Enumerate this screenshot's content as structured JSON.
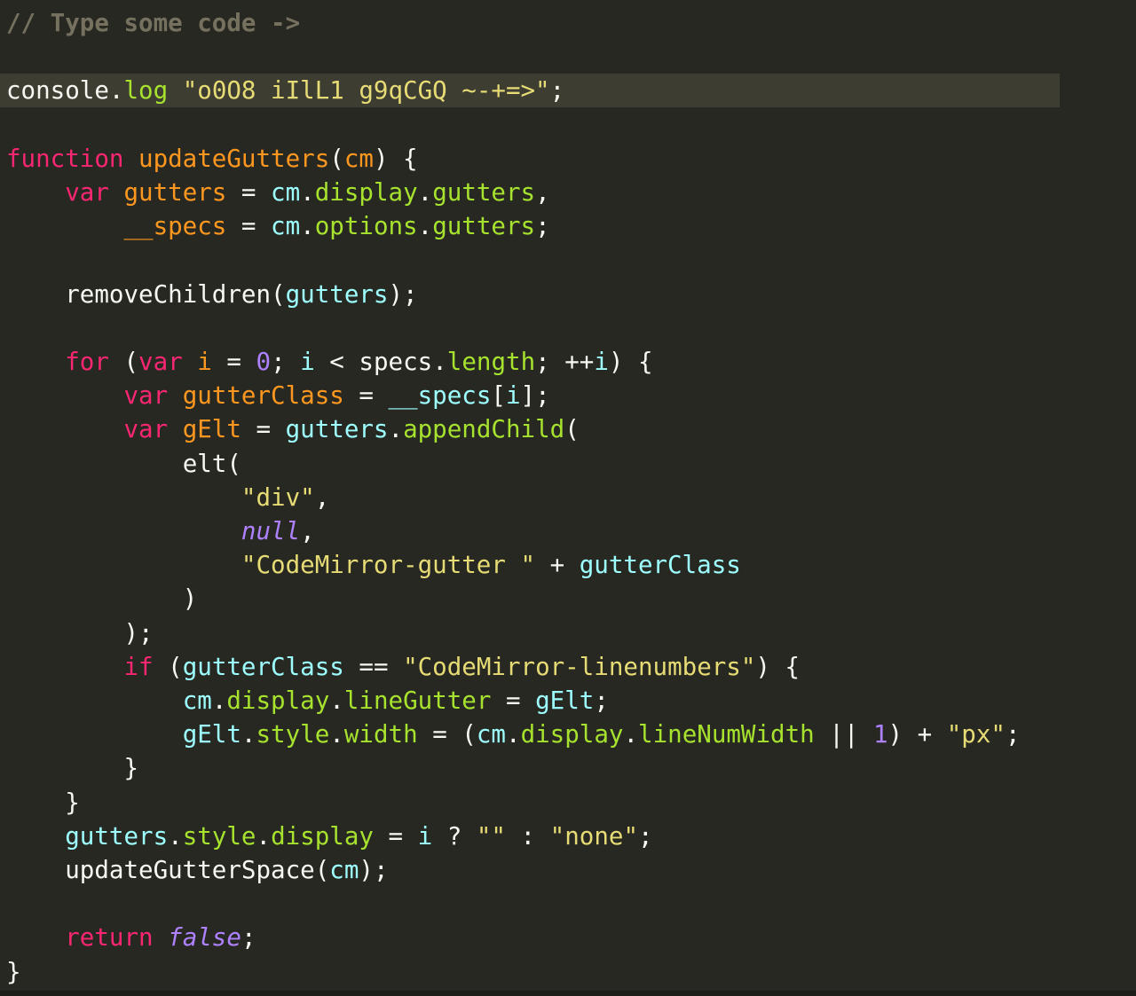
{
  "editor": {
    "theme_colors": {
      "background": "#272822",
      "active_line": "#3e3d32",
      "comment": "#75715e",
      "keyword": "#f92672",
      "definition": "#fd971f",
      "property": "#a6e22e",
      "variable": "#9effff",
      "string": "#e6db74",
      "number": "#ae81ff",
      "text": "#f8f8f2"
    },
    "active_line_index": 2,
    "lines": [
      [
        {
          "t": "// Type some code ->",
          "c": "comment"
        }
      ],
      [],
      [
        {
          "t": "console",
          "c": "plain"
        },
        {
          "t": ".",
          "c": "plain"
        },
        {
          "t": "log",
          "c": "prop"
        },
        {
          "t": " ",
          "c": "plain"
        },
        {
          "t": "\"o0O8 iIlL1 g9qCGQ ~-+=>\"",
          "c": "str"
        },
        {
          "t": ";",
          "c": "plain"
        }
      ],
      [],
      [
        {
          "t": "function",
          "c": "kw"
        },
        {
          "t": " ",
          "c": "plain"
        },
        {
          "t": "updateGutters",
          "c": "fn"
        },
        {
          "t": "(",
          "c": "plain"
        },
        {
          "t": "cm",
          "c": "param"
        },
        {
          "t": ") {",
          "c": "plain"
        }
      ],
      [
        {
          "t": "    ",
          "c": "plain"
        },
        {
          "t": "var",
          "c": "kw"
        },
        {
          "t": " ",
          "c": "plain"
        },
        {
          "t": "gutters",
          "c": "defvar"
        },
        {
          "t": " = ",
          "c": "plain"
        },
        {
          "t": "cm",
          "c": "var2"
        },
        {
          "t": ".",
          "c": "plain"
        },
        {
          "t": "display",
          "c": "prop"
        },
        {
          "t": ".",
          "c": "plain"
        },
        {
          "t": "gutters",
          "c": "prop"
        },
        {
          "t": ",",
          "c": "plain"
        }
      ],
      [
        {
          "t": "        ",
          "c": "plain"
        },
        {
          "t": "__specs",
          "c": "defvar"
        },
        {
          "t": " = ",
          "c": "plain"
        },
        {
          "t": "cm",
          "c": "var2"
        },
        {
          "t": ".",
          "c": "plain"
        },
        {
          "t": "options",
          "c": "prop"
        },
        {
          "t": ".",
          "c": "plain"
        },
        {
          "t": "gutters",
          "c": "prop"
        },
        {
          "t": ";",
          "c": "plain"
        }
      ],
      [],
      [
        {
          "t": "    ",
          "c": "plain"
        },
        {
          "t": "removeChildren",
          "c": "plain"
        },
        {
          "t": "(",
          "c": "plain"
        },
        {
          "t": "gutters",
          "c": "var2"
        },
        {
          "t": ");",
          "c": "plain"
        }
      ],
      [],
      [
        {
          "t": "    ",
          "c": "plain"
        },
        {
          "t": "for",
          "c": "kw"
        },
        {
          "t": " (",
          "c": "plain"
        },
        {
          "t": "var",
          "c": "kw"
        },
        {
          "t": " ",
          "c": "plain"
        },
        {
          "t": "i",
          "c": "defvar"
        },
        {
          "t": " = ",
          "c": "plain"
        },
        {
          "t": "0",
          "c": "num"
        },
        {
          "t": "; ",
          "c": "plain"
        },
        {
          "t": "i",
          "c": "var2"
        },
        {
          "t": " < ",
          "c": "plain"
        },
        {
          "t": "specs",
          "c": "plain"
        },
        {
          "t": ".",
          "c": "plain"
        },
        {
          "t": "length",
          "c": "prop"
        },
        {
          "t": "; ++",
          "c": "plain"
        },
        {
          "t": "i",
          "c": "var2"
        },
        {
          "t": ") {",
          "c": "plain"
        }
      ],
      [
        {
          "t": "        ",
          "c": "plain"
        },
        {
          "t": "var",
          "c": "kw"
        },
        {
          "t": " ",
          "c": "plain"
        },
        {
          "t": "gutterClass",
          "c": "defvar"
        },
        {
          "t": " = ",
          "c": "plain"
        },
        {
          "t": "__specs",
          "c": "var2"
        },
        {
          "t": "[",
          "c": "plain"
        },
        {
          "t": "i",
          "c": "var2"
        },
        {
          "t": "];",
          "c": "plain"
        }
      ],
      [
        {
          "t": "        ",
          "c": "plain"
        },
        {
          "t": "var",
          "c": "kw"
        },
        {
          "t": " ",
          "c": "plain"
        },
        {
          "t": "gElt",
          "c": "defvar"
        },
        {
          "t": " = ",
          "c": "plain"
        },
        {
          "t": "gutters",
          "c": "var2"
        },
        {
          "t": ".",
          "c": "plain"
        },
        {
          "t": "appendChild",
          "c": "prop"
        },
        {
          "t": "(",
          "c": "plain"
        }
      ],
      [
        {
          "t": "            ",
          "c": "plain"
        },
        {
          "t": "elt",
          "c": "plain"
        },
        {
          "t": "(",
          "c": "plain"
        }
      ],
      [
        {
          "t": "                ",
          "c": "plain"
        },
        {
          "t": "\"div\"",
          "c": "str"
        },
        {
          "t": ",",
          "c": "plain"
        }
      ],
      [
        {
          "t": "                ",
          "c": "plain"
        },
        {
          "t": "null",
          "c": "atom"
        },
        {
          "t": ",",
          "c": "plain"
        }
      ],
      [
        {
          "t": "                ",
          "c": "plain"
        },
        {
          "t": "\"CodeMirror-gutter \"",
          "c": "str"
        },
        {
          "t": " + ",
          "c": "plain"
        },
        {
          "t": "gutterClass",
          "c": "var2"
        }
      ],
      [
        {
          "t": "            ",
          "c": "plain"
        },
        {
          "t": ")",
          "c": "plain"
        }
      ],
      [
        {
          "t": "        ",
          "c": "plain"
        },
        {
          "t": ");",
          "c": "plain"
        }
      ],
      [
        {
          "t": "        ",
          "c": "plain"
        },
        {
          "t": "if",
          "c": "kw"
        },
        {
          "t": " (",
          "c": "plain"
        },
        {
          "t": "gutterClass",
          "c": "var2"
        },
        {
          "t": " == ",
          "c": "plain"
        },
        {
          "t": "\"CodeMirror-linenumbers\"",
          "c": "str"
        },
        {
          "t": ") {",
          "c": "plain"
        }
      ],
      [
        {
          "t": "            ",
          "c": "plain"
        },
        {
          "t": "cm",
          "c": "var2"
        },
        {
          "t": ".",
          "c": "plain"
        },
        {
          "t": "display",
          "c": "prop"
        },
        {
          "t": ".",
          "c": "plain"
        },
        {
          "t": "lineGutter",
          "c": "prop"
        },
        {
          "t": " = ",
          "c": "plain"
        },
        {
          "t": "gElt",
          "c": "var2"
        },
        {
          "t": ";",
          "c": "plain"
        }
      ],
      [
        {
          "t": "            ",
          "c": "plain"
        },
        {
          "t": "gElt",
          "c": "var2"
        },
        {
          "t": ".",
          "c": "plain"
        },
        {
          "t": "style",
          "c": "prop"
        },
        {
          "t": ".",
          "c": "plain"
        },
        {
          "t": "width",
          "c": "prop"
        },
        {
          "t": " = (",
          "c": "plain"
        },
        {
          "t": "cm",
          "c": "var2"
        },
        {
          "t": ".",
          "c": "plain"
        },
        {
          "t": "display",
          "c": "prop"
        },
        {
          "t": ".",
          "c": "plain"
        },
        {
          "t": "lineNumWidth",
          "c": "prop"
        },
        {
          "t": " || ",
          "c": "plain"
        },
        {
          "t": "1",
          "c": "num"
        },
        {
          "t": ") + ",
          "c": "plain"
        },
        {
          "t": "\"px\"",
          "c": "str"
        },
        {
          "t": ";",
          "c": "plain"
        }
      ],
      [
        {
          "t": "        ",
          "c": "plain"
        },
        {
          "t": "}",
          "c": "plain"
        }
      ],
      [
        {
          "t": "    ",
          "c": "plain"
        },
        {
          "t": "}",
          "c": "plain"
        }
      ],
      [
        {
          "t": "    ",
          "c": "plain"
        },
        {
          "t": "gutters",
          "c": "var2"
        },
        {
          "t": ".",
          "c": "plain"
        },
        {
          "t": "style",
          "c": "prop"
        },
        {
          "t": ".",
          "c": "plain"
        },
        {
          "t": "display",
          "c": "prop"
        },
        {
          "t": " = ",
          "c": "plain"
        },
        {
          "t": "i",
          "c": "var2"
        },
        {
          "t": " ? ",
          "c": "plain"
        },
        {
          "t": "\"\"",
          "c": "str"
        },
        {
          "t": " : ",
          "c": "plain"
        },
        {
          "t": "\"none\"",
          "c": "str"
        },
        {
          "t": ";",
          "c": "plain"
        }
      ],
      [
        {
          "t": "    ",
          "c": "plain"
        },
        {
          "t": "updateGutterSpace",
          "c": "plain"
        },
        {
          "t": "(",
          "c": "plain"
        },
        {
          "t": "cm",
          "c": "var2"
        },
        {
          "t": ");",
          "c": "plain"
        }
      ],
      [],
      [
        {
          "t": "    ",
          "c": "plain"
        },
        {
          "t": "return",
          "c": "kw"
        },
        {
          "t": " ",
          "c": "plain"
        },
        {
          "t": "false",
          "c": "atom"
        },
        {
          "t": ";",
          "c": "plain"
        }
      ],
      [
        {
          "t": "}",
          "c": "plain"
        }
      ]
    ]
  }
}
